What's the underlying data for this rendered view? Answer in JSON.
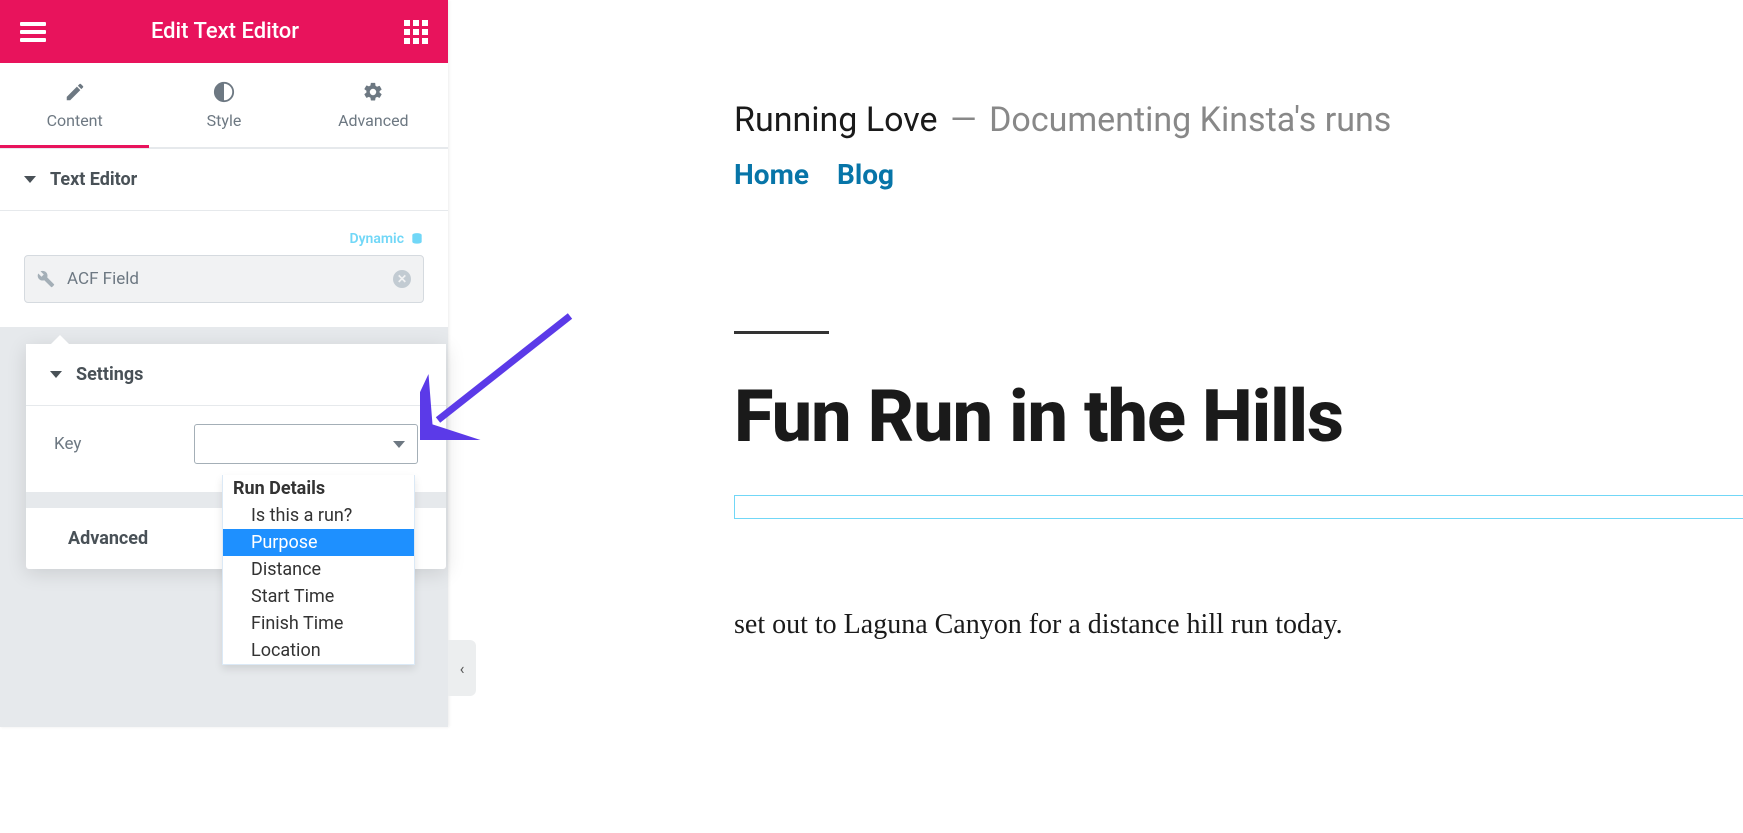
{
  "header": {
    "title": "Edit Text Editor"
  },
  "tabs": {
    "content": "Content",
    "style": "Style",
    "advanced": "Advanced"
  },
  "sections": {
    "textEditor": {
      "label": "Text Editor"
    },
    "dynamic": "Dynamic",
    "fieldInput": "ACF Field",
    "settings": {
      "label": "Settings",
      "keyLabel": "Key"
    },
    "advanced": {
      "label": "Advanced"
    }
  },
  "dropdown": {
    "group": "Run Details",
    "options": [
      "Is this a run?",
      "Purpose",
      "Distance",
      "Start Time",
      "Finish Time",
      "Location"
    ],
    "selected": "Purpose"
  },
  "preview": {
    "siteTitle": "Running Love",
    "dash": "—",
    "tagline": "Documenting Kinsta's runs",
    "nav": {
      "home": "Home",
      "blog": "Blog"
    },
    "postTitle": "Fun Run in the Hills",
    "body": "set out to Laguna Canyon for a distance hill run today."
  },
  "collapseGlyph": "‹"
}
